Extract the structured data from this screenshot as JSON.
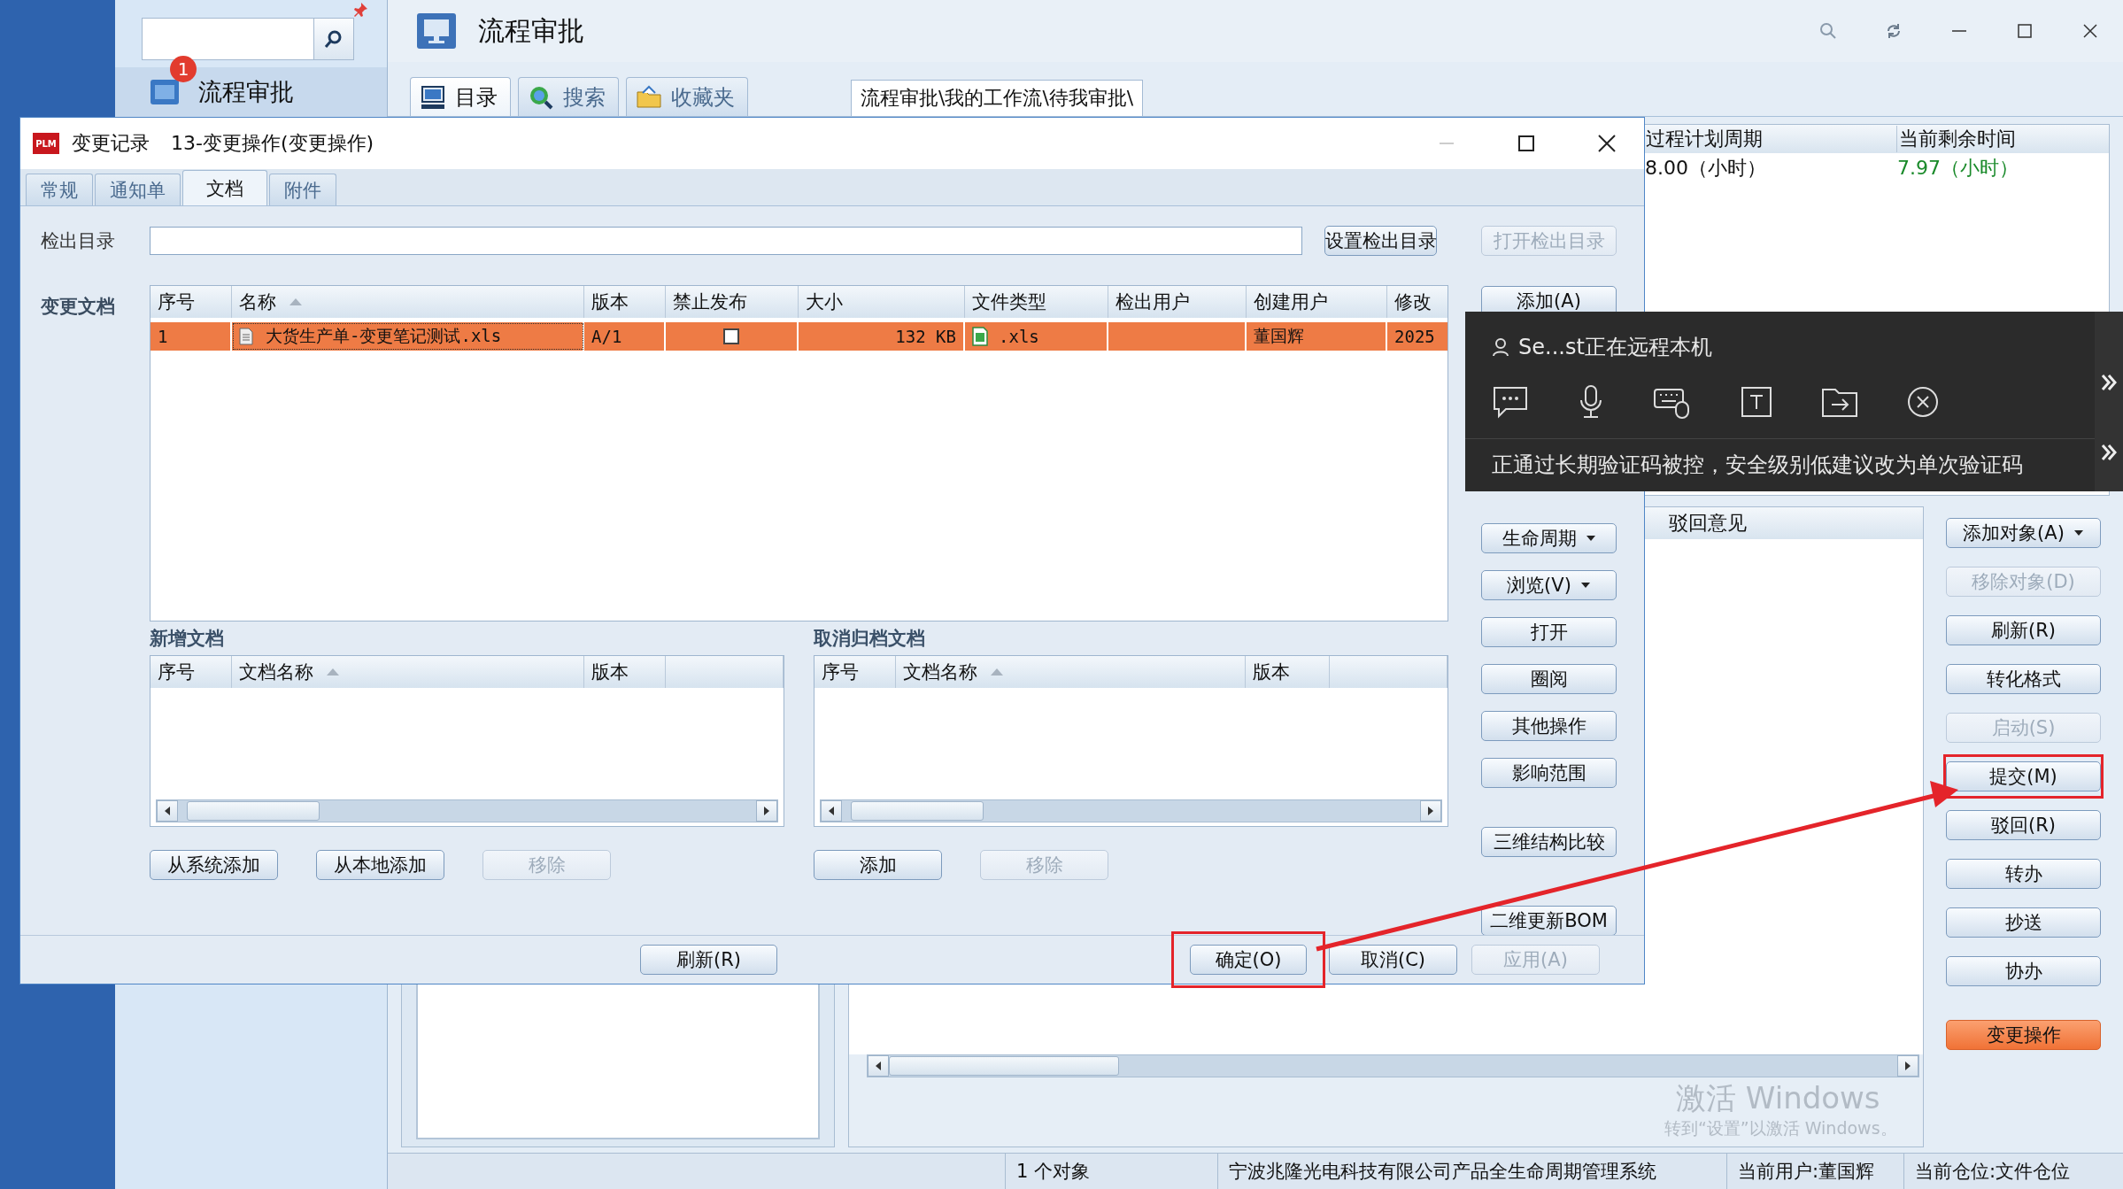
{
  "sidebar": {
    "badge": "1",
    "item": "流程审批"
  },
  "main_window": {
    "title": "流程审批",
    "tabs": [
      {
        "label": "目录",
        "selected": true
      },
      {
        "label": "搜索",
        "selected": false
      },
      {
        "label": "收藏夹",
        "selected": false
      }
    ],
    "breadcrumb": "流程审批\\我的工作流\\待我审批\\",
    "process_table": {
      "columns": [
        "过程计划周期",
        "当前剩余时间"
      ],
      "rows": [
        [
          "8.00（小时）",
          "7.97（小时）"
        ]
      ]
    },
    "opinion_column": "驳回意见",
    "actions": [
      {
        "label": "添加对象(A)",
        "dropdown": true,
        "disabled": false,
        "highlighted": false,
        "kind": "normal"
      },
      {
        "label": "移除对象(D)",
        "dropdown": false,
        "disabled": true,
        "highlighted": false,
        "kind": "normal"
      },
      {
        "label": "刷新(R)",
        "dropdown": false,
        "disabled": false,
        "highlighted": false,
        "kind": "normal"
      },
      {
        "label": "转化格式",
        "dropdown": false,
        "disabled": false,
        "highlighted": false,
        "kind": "normal"
      },
      {
        "label": "启动(S)",
        "dropdown": false,
        "disabled": true,
        "highlighted": false,
        "kind": "normal"
      },
      {
        "label": "提交(M)",
        "dropdown": false,
        "disabled": false,
        "highlighted": true,
        "kind": "normal"
      },
      {
        "label": "驳回(R)",
        "dropdown": false,
        "disabled": false,
        "highlighted": false,
        "kind": "normal"
      },
      {
        "label": "转办",
        "dropdown": false,
        "disabled": false,
        "highlighted": false,
        "kind": "normal"
      },
      {
        "label": "抄送",
        "dropdown": false,
        "disabled": false,
        "highlighted": false,
        "kind": "normal"
      },
      {
        "label": "协办",
        "dropdown": false,
        "disabled": false,
        "highlighted": false,
        "kind": "normal"
      },
      {
        "label": "变更操作",
        "dropdown": false,
        "disabled": false,
        "highlighted": false,
        "kind": "primary"
      }
    ],
    "status_bar": [
      "1 个对象",
      "宁波兆隆光电科技有限公司产品全生命周期管理系统",
      "当前用户:董国辉",
      "当前仓位:文件仓位"
    ]
  },
  "dialog": {
    "logo": "PLM",
    "title": "变更记录",
    "subtitle": "13-变更操作(变更操作)",
    "tabs": [
      {
        "label": "常规",
        "selected": false
      },
      {
        "label": "通知单",
        "selected": false
      },
      {
        "label": "文档",
        "selected": true
      },
      {
        "label": "附件",
        "selected": false
      }
    ],
    "checkout": {
      "label": "检出目录",
      "buttons": [
        {
          "label": "设置检出目录",
          "disabled": false
        },
        {
          "label": "打开检出目录",
          "disabled": true
        }
      ]
    },
    "documents": {
      "label": "变更文档",
      "columns": [
        {
          "label": "序号",
          "sorted": false
        },
        {
          "label": "名称",
          "sorted": true
        },
        {
          "label": "版本",
          "sorted": false
        },
        {
          "label": "禁止发布",
          "sorted": false
        },
        {
          "label": "大小",
          "sorted": false
        },
        {
          "label": "文件类型",
          "sorted": false
        },
        {
          "label": "检出用户",
          "sorted": false
        },
        {
          "label": "创建用户",
          "sorted": false
        },
        {
          "label": "修改",
          "sorted": false
        }
      ],
      "rows": [
        {
          "selected": true,
          "index": "1",
          "name": "大货生产单-变更笔记测试.xls",
          "version": "A/1",
          "no_publish": false,
          "size": "132 KB",
          "file_type": ".xls",
          "creator": "董国辉",
          "modified": "2025"
        }
      ]
    },
    "tool_buttons": [
      [
        {
          "label": "添加(A)",
          "dropdown": false
        }
      ],
      [
        {
          "label": "生命周期",
          "dropdown": true
        },
        {
          "label": "浏览(V)",
          "dropdown": true
        },
        {
          "label": "打开",
          "dropdown": false
        },
        {
          "label": "圈阅",
          "dropdown": false
        },
        {
          "label": "其他操作",
          "dropdown": false
        },
        {
          "label": "影响范围",
          "dropdown": false
        }
      ],
      [
        {
          "label": "三维结构比较",
          "dropdown": false
        }
      ],
      [
        {
          "label": "二维更新BOM",
          "dropdown": false
        }
      ]
    ],
    "new_docs": {
      "label": "新增文档",
      "columns": [
        {
          "label": "序号",
          "sorted": false
        },
        {
          "label": "文档名称",
          "sorted": true
        },
        {
          "label": "版本",
          "sorted": false
        }
      ],
      "buttons": [
        {
          "label": "从系统添加",
          "disabled": false
        },
        {
          "label": "从本地添加",
          "disabled": false
        },
        {
          "label": "移除",
          "disabled": true
        }
      ]
    },
    "cancelled_docs": {
      "label": "取消归档文档",
      "columns": [
        {
          "label": "序号",
          "sorted": false
        },
        {
          "label": "文档名称",
          "sorted": true
        },
        {
          "label": "版本",
          "sorted": false
        }
      ],
      "buttons": [
        {
          "label": "添加",
          "disabled": false
        },
        {
          "label": "移除",
          "disabled": true
        }
      ]
    },
    "footer_buttons": [
      {
        "label": "刷新(R)",
        "disabled": false,
        "highlighted": false
      },
      {
        "label": "确定(O)",
        "disabled": false,
        "highlighted": true
      },
      {
        "label": "取消(C)",
        "disabled": false,
        "highlighted": false
      },
      {
        "label": "应用(A)",
        "disabled": true,
        "highlighted": false
      }
    ]
  },
  "remote_panel": {
    "status": "Se...st正在远程本机",
    "warning": "正通过长期验证码被控，安全级别低建议改为单次验证码"
  },
  "os_watermark": {
    "title": "激活 Windows",
    "hint": "转到“设置”以激活 Windows。"
  }
}
